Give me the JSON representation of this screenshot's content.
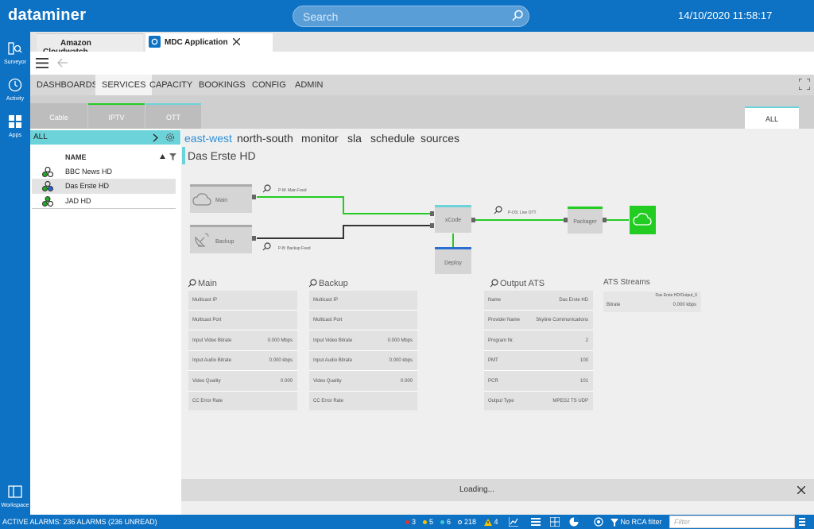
{
  "app": {
    "logo": "dataminer",
    "search_placeholder": "Search",
    "datetime": "14/10/2020 11:58:17"
  },
  "nav": [
    {
      "label": "Surveyor",
      "icon": "surveyor-icon"
    },
    {
      "label": "Activity",
      "icon": "activity-icon"
    },
    {
      "label": "Apps",
      "icon": "apps-icon"
    },
    {
      "label": "Workspace",
      "icon": "workspace-icon"
    }
  ],
  "tabs": [
    {
      "label": "Amazon Cloudwatch"
    },
    {
      "label": "MDC Application"
    }
  ],
  "menu": [
    {
      "label": "DASHBOARDS"
    },
    {
      "label": "SERVICES"
    },
    {
      "label": "CAPACITY"
    },
    {
      "label": "BOOKINGS"
    },
    {
      "label": "CONFIG"
    },
    {
      "label": "ADMIN"
    }
  ],
  "subtabs": [
    {
      "label": "Cable"
    },
    {
      "label": "IPTV"
    },
    {
      "label": "OTT"
    }
  ],
  "subtab_all": "ALL",
  "sidebar": {
    "filter_label": "ALL",
    "column_header": "NAME",
    "items": [
      {
        "label": "BBC News HD"
      },
      {
        "label": "Das Erste HD"
      },
      {
        "label": "JAD HD"
      }
    ]
  },
  "view_tabs": [
    {
      "label": "east-west"
    },
    {
      "label": "north-south"
    },
    {
      "label": "monitor"
    },
    {
      "label": "sla"
    },
    {
      "label": "schedule"
    },
    {
      "label": "sources"
    }
  ],
  "service_title": "Das Erste HD",
  "diagram": {
    "main": "Main",
    "backup": "Backup",
    "xcode": "xCode",
    "deploy": "Deploy",
    "packager": "Packager",
    "feed_main": "P-M: Main Feed",
    "feed_backup": "P-B: Backup Feed",
    "feed_ott": "P-OS: Live OTT"
  },
  "cards": {
    "main": {
      "title": "Main",
      "rows": [
        {
          "k": "Multicast IP",
          "v": ""
        },
        {
          "k": "Multicast Port",
          "v": ""
        },
        {
          "k": "Input Video Bitrate",
          "v": "0.000 Mbps"
        },
        {
          "k": "Input Audio Bitrate",
          "v": "0.000 kbps"
        },
        {
          "k": "Video Quality",
          "v": "0.000"
        },
        {
          "k": "CC Error Rate",
          "v": ""
        }
      ]
    },
    "backup": {
      "title": "Backup",
      "rows": [
        {
          "k": "Multicast IP",
          "v": ""
        },
        {
          "k": "Multicast Port",
          "v": ""
        },
        {
          "k": "Input Video Bitrate",
          "v": "0.000 Mbps"
        },
        {
          "k": "Input Audio Bitrate",
          "v": "0.000 kbps"
        },
        {
          "k": "Video Quality",
          "v": "0.000"
        },
        {
          "k": "CC Error Rate",
          "v": ""
        }
      ]
    },
    "output": {
      "title": "Output ATS",
      "rows": [
        {
          "k": "Name",
          "v": "Das Erste HD"
        },
        {
          "k": "Provider Name",
          "v": "Skyline Communications"
        },
        {
          "k": "Program Nr.",
          "v": "2"
        },
        {
          "k": "PMT",
          "v": "100"
        },
        {
          "k": "PCR",
          "v": "101"
        },
        {
          "k": "Output Type",
          "v": "MPEG2 TS UDP"
        }
      ]
    },
    "streams": {
      "title": "ATS Streams",
      "header": "Das Erste HD/Output_6",
      "row_label": "Bitrate",
      "row_value": "0.000 kbps"
    }
  },
  "loading": "Loading...",
  "status": {
    "alarms": "ACTIVE ALARMS: 236 ALARMS (236 UNREAD)",
    "counts": [
      {
        "value": "3",
        "color": "#e2322b"
      },
      {
        "value": "5",
        "color": "#f5c400"
      },
      {
        "value": "6",
        "color": "#42c7d6"
      },
      {
        "value": "218",
        "color": "#2d6fb3"
      }
    ],
    "warnings": "4",
    "rca": "No RCA filter",
    "filter_placeholder": "Filter"
  },
  "colors": {
    "brand": "#0e72c4",
    "accent": "#6dd3da",
    "ok": "#22cc22"
  }
}
